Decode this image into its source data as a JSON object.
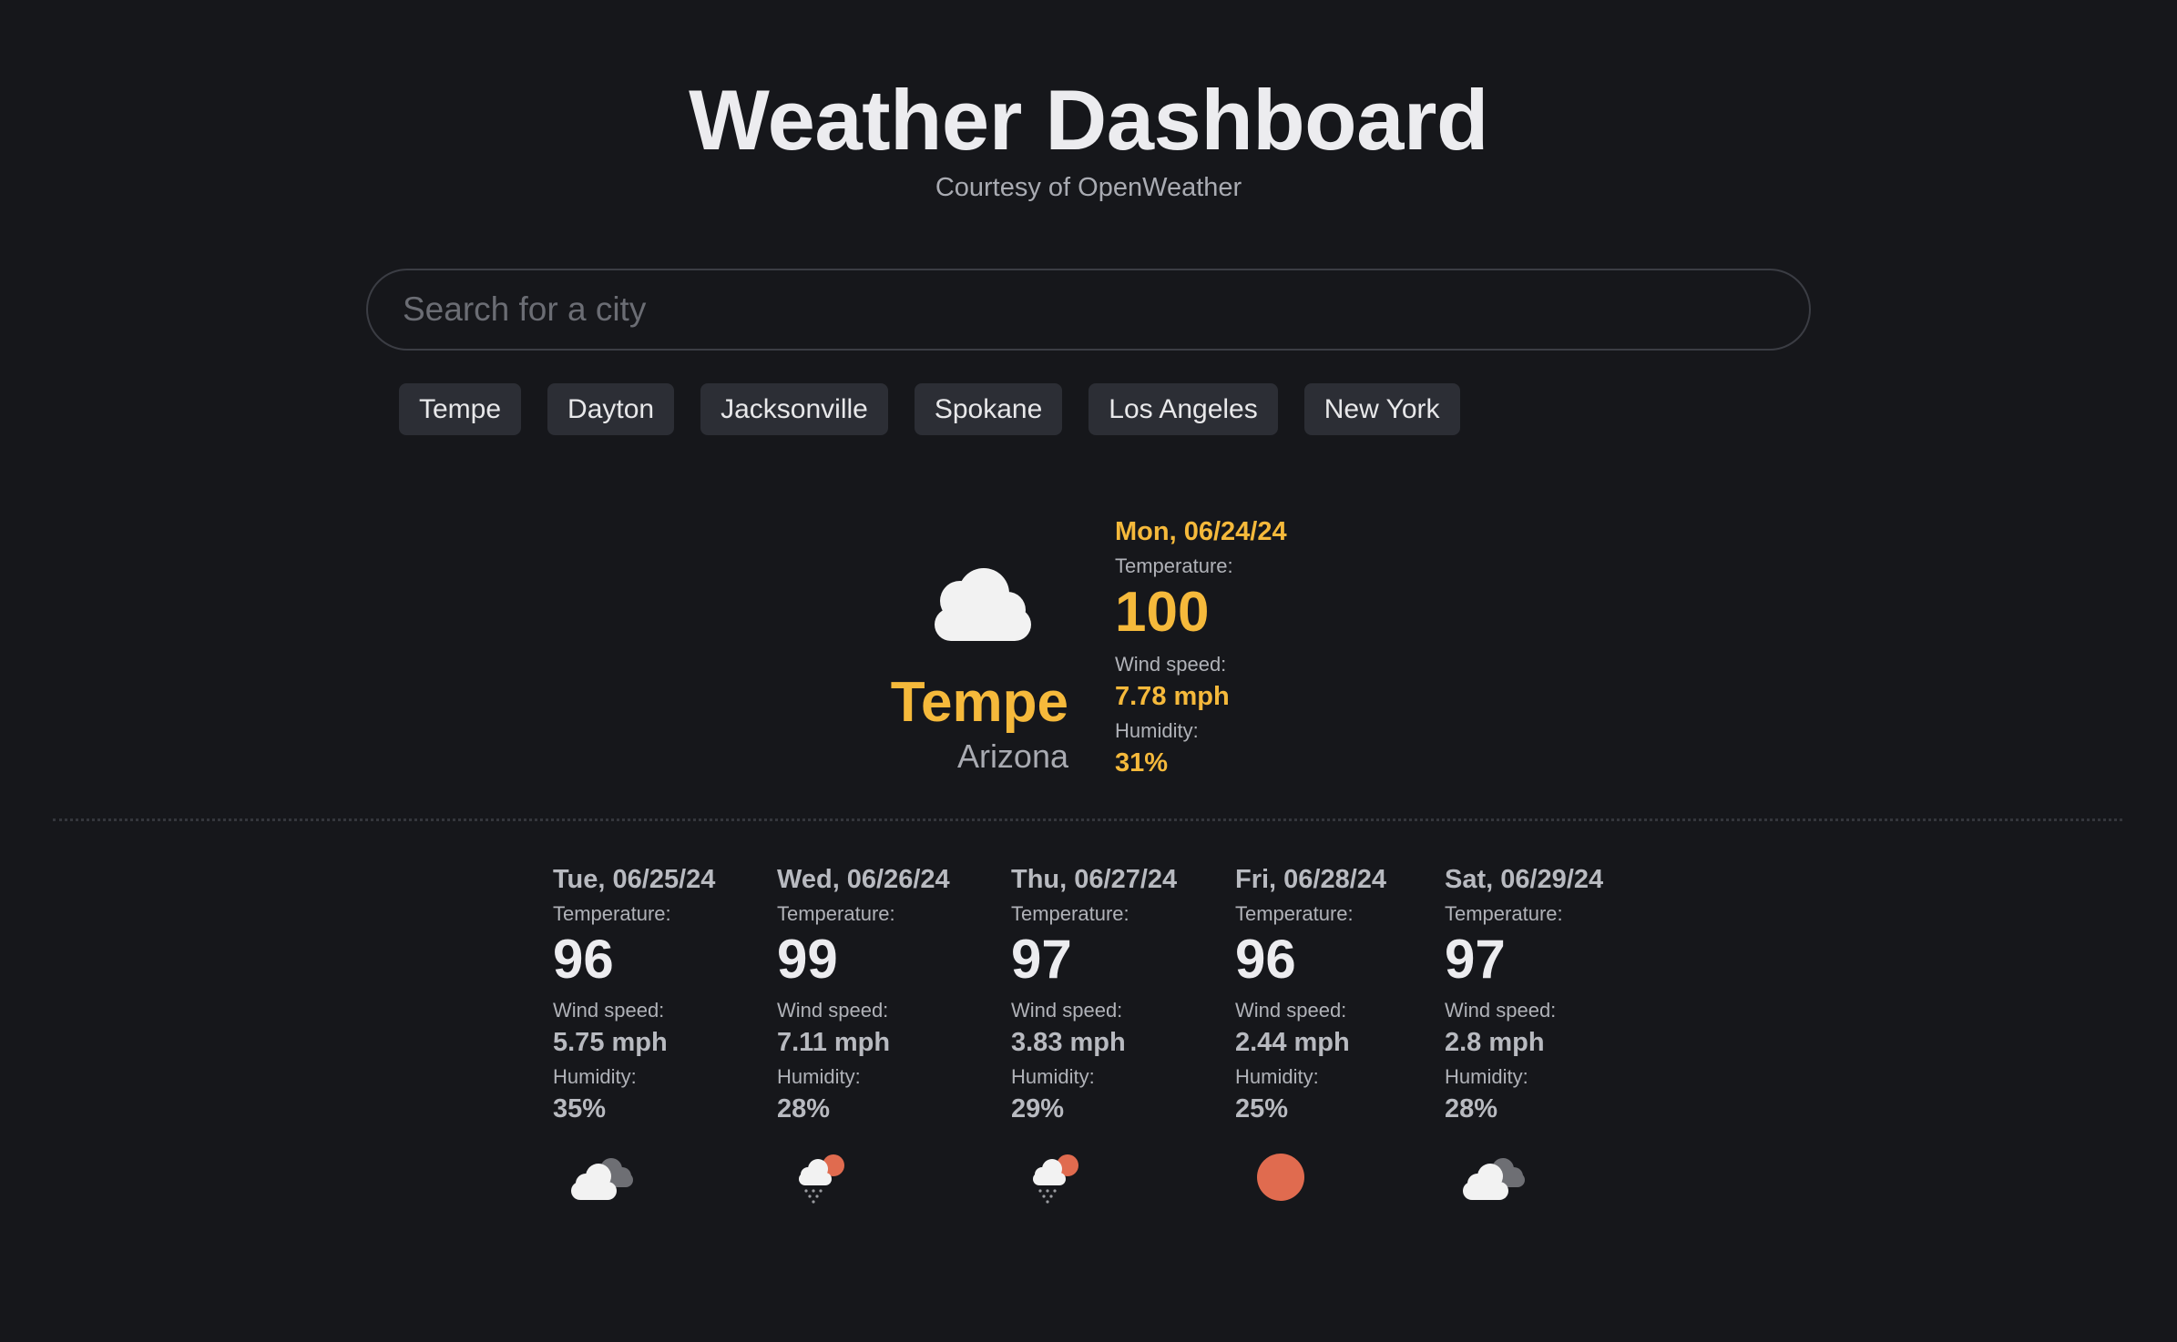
{
  "header": {
    "title": "Weather Dashboard",
    "subtitle": "Courtesy of OpenWeather"
  },
  "search": {
    "placeholder": "Search for a city",
    "value": ""
  },
  "quick_cities": [
    "Tempe",
    "Dayton",
    "Jacksonville",
    "Spokane",
    "Los Angeles",
    "New York"
  ],
  "current": {
    "city": "Tempe",
    "region": "Arizona",
    "date": "Mon, 06/24/24",
    "temperature_label": "Temperature:",
    "temperature": "100",
    "wind_label": "Wind speed:",
    "wind": "7.78 mph",
    "humidity_label": "Humidity:",
    "humidity": "31%",
    "icon": "cloud-icon"
  },
  "forecast": [
    {
      "date": "Tue, 06/25/24",
      "temperature_label": "Temperature:",
      "temperature": "96",
      "wind_label": "Wind speed:",
      "wind": "5.75 mph",
      "humidity_label": "Humidity:",
      "humidity": "35%",
      "icon": "broken-clouds-icon"
    },
    {
      "date": "Wed, 06/26/24",
      "temperature_label": "Temperature:",
      "temperature": "99",
      "wind_label": "Wind speed:",
      "wind": "7.11 mph",
      "humidity_label": "Humidity:",
      "humidity": "28%",
      "icon": "rain-sun-icon"
    },
    {
      "date": "Thu, 06/27/24",
      "temperature_label": "Temperature:",
      "temperature": "97",
      "wind_label": "Wind speed:",
      "wind": "3.83 mph",
      "humidity_label": "Humidity:",
      "humidity": "29%",
      "icon": "rain-sun-icon"
    },
    {
      "date": "Fri, 06/28/24",
      "temperature_label": "Temperature:",
      "temperature": "96",
      "wind_label": "Wind speed:",
      "wind": "2.44 mph",
      "humidity_label": "Humidity:",
      "humidity": "25%",
      "icon": "sun-icon"
    },
    {
      "date": "Sat, 06/29/24",
      "temperature_label": "Temperature:",
      "temperature": "97",
      "wind_label": "Wind speed:",
      "wind": "2.8 mph",
      "humidity_label": "Humidity:",
      "humidity": "28%",
      "icon": "broken-clouds-icon"
    }
  ],
  "colors": {
    "background": "#16171b",
    "accent": "#f5b93b",
    "chip": "#2c2e35",
    "sun": "#e06b4f",
    "text_primary": "#ececef",
    "text_muted": "#b8bac0"
  }
}
